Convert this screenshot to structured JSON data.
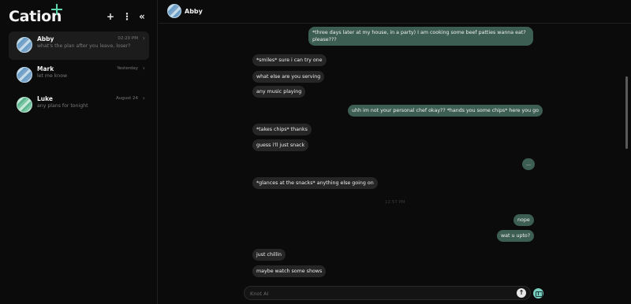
{
  "brand": {
    "name": "Cation"
  },
  "sidebar": {
    "chats": [
      {
        "name": "Abby",
        "preview": "what's the plan after you leave, loser?",
        "time": "02:20 PM"
      },
      {
        "name": "Mark",
        "preview": "let me know",
        "time": "Yesterday"
      },
      {
        "name": "Luke",
        "preview": "any plans for tonight",
        "time": "August 24"
      }
    ]
  },
  "header": {
    "name": "Abby"
  },
  "messages": [
    {
      "role": "user",
      "text": "*three days later at my house, in a party) I am cooking some beef patties wanna eat? please???"
    },
    {
      "role": "bot",
      "text": "*smiles* sure i can try one"
    },
    {
      "role": "bot",
      "text": "what else are you serving"
    },
    {
      "role": "bot",
      "text": "any music playing"
    },
    {
      "role": "user",
      "text": "uhh im not your personal chef okay?? *hands you some chips* here you go"
    },
    {
      "role": "bot",
      "text": "*takes chips* thanks"
    },
    {
      "role": "bot",
      "text": "guess i'll just snack"
    },
    {
      "role": "user",
      "text": "..."
    },
    {
      "role": "bot",
      "text": "*glances at the snacks* anything else going on"
    },
    {
      "role": "user",
      "text": "nope"
    },
    {
      "role": "user",
      "text": "wat u upto?"
    },
    {
      "role": "bot",
      "text": "just chillin"
    },
    {
      "role": "bot",
      "text": "maybe watch some shows"
    }
  ],
  "timestamp": "12:57 PM",
  "input": {
    "placeholder": "Knot AI"
  },
  "colors": {
    "accent": "#5fd3ae",
    "user_bubble": "#3d5e53",
    "bot_bubble": "#262626"
  }
}
